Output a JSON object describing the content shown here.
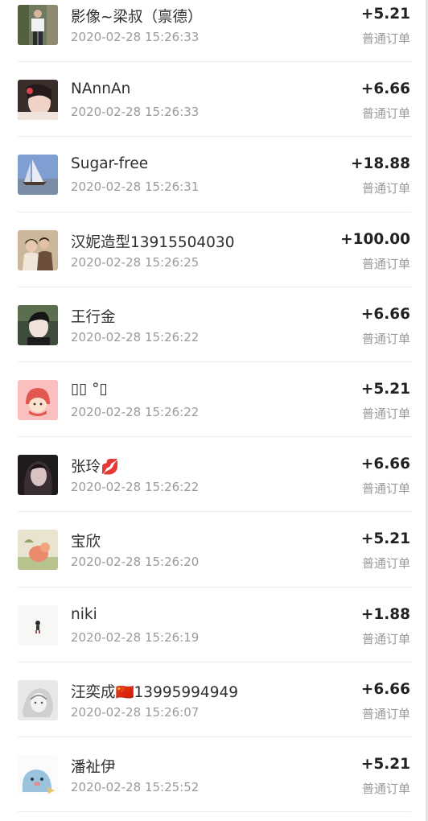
{
  "orders": [
    {
      "name": "影像~梁叔（禀德）",
      "time": "2020-02-28 15:26:33",
      "amount": "+5.21",
      "type": "普通订单",
      "avatar_icon": "person-standing-photo-avatar"
    },
    {
      "name": "NAnnAn",
      "time": "2020-02-28 15:26:33",
      "amount": "+6.66",
      "type": "普通订单",
      "avatar_icon": "girl-selfie-avatar"
    },
    {
      "name": "Sugar-free",
      "time": "2020-02-28 15:26:31",
      "amount": "+18.88",
      "type": "普通订单",
      "avatar_icon": "sailboat-landscape-avatar"
    },
    {
      "name": "汉妮造型13915504030",
      "time": "2020-02-28 15:26:25",
      "amount": "+100.00",
      "type": "普通订单",
      "avatar_icon": "couple-photo-avatar"
    },
    {
      "name": "王行金",
      "time": "2020-02-28 15:26:22",
      "amount": "+6.66",
      "type": "普通订单",
      "avatar_icon": "man-portrait-avatar"
    },
    {
      "name": "▯▯ °▯",
      "time": "2020-02-28 15:26:22",
      "amount": "+5.21",
      "type": "普通订单",
      "avatar_icon": "cartoon-girl-avatar"
    },
    {
      "name": "张玲💋",
      "time": "2020-02-28 15:26:22",
      "amount": "+6.66",
      "type": "普通订单",
      "avatar_icon": "dark-portrait-avatar"
    },
    {
      "name": "宝欣",
      "time": "2020-02-28 15:26:20",
      "amount": "+5.21",
      "type": "普通订单",
      "avatar_icon": "illustrated-creature-avatar"
    },
    {
      "name": "niki",
      "time": "2020-02-28 15:26:19",
      "amount": "+1.88",
      "type": "普通订单",
      "avatar_icon": "tiny-figure-avatar"
    },
    {
      "name": "汪奕成🇨🇳13995994949",
      "time": "2020-02-28 15:26:07",
      "amount": "+6.66",
      "type": "普通订单",
      "avatar_icon": "sketch-portrait-avatar"
    },
    {
      "name": "潘祉伊",
      "time": "2020-02-28 15:25:52",
      "amount": "+5.21",
      "type": "普通订单",
      "avatar_icon": "blue-cartoon-avatar"
    }
  ],
  "colors": {
    "text_primary": "#2f2f2f",
    "text_secondary": "#9a9a9a",
    "divider": "#ececec"
  }
}
